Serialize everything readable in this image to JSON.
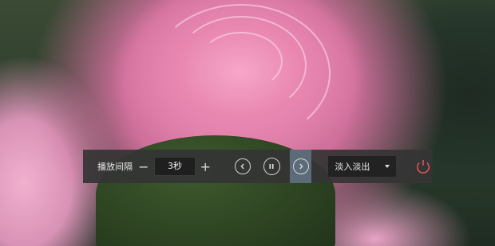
{
  "toolbar": {
    "interval_label": "播放间隔",
    "interval_value": "3秒",
    "effect_value": "淡入淡出"
  },
  "icons": {
    "minus": "minus-icon",
    "plus": "plus-icon",
    "previous": "chevron-left-icon",
    "pause": "pause-icon",
    "next": "chevron-right-icon",
    "dropdown": "caret-down-icon",
    "power": "power-icon"
  },
  "colors": {
    "toolbar_bg": "#343434",
    "next_highlight": "#5b6c78",
    "power_accent": "#e05a5a"
  }
}
